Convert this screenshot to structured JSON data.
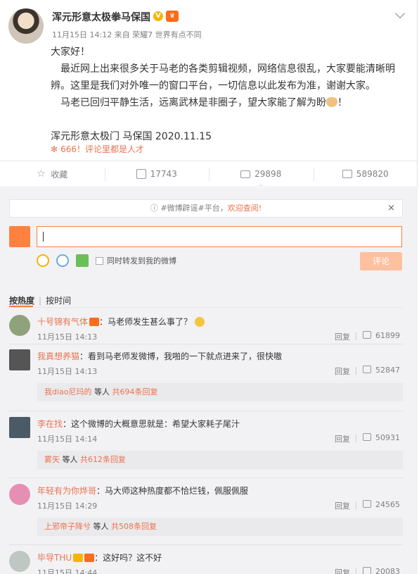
{
  "post": {
    "author": "浑元形意太极拳马保国",
    "verified_badge": "V",
    "meta": "11月15日 14:12 来自 荣耀7 世界有点不同",
    "greeting": "大家好！",
    "para1": "最近网上出来很多关于马老的各类剪辑视频，网络信息很乱，大家要能清晰明辨。这里是我们对外唯一的窗口平台，一切信息以此发布为准，谢谢大家。",
    "para2": "马老已回归平静生活，远离武林是非圈子，望大家能了解为盼",
    "para2_end": "！",
    "signature": "浑元形意太极门   马保国   2020.11.15",
    "hot_comment_tag": "666！评论里都是人才"
  },
  "actions": {
    "favorite": "收藏",
    "repost_count": "17743",
    "comment_count": "29898",
    "like_count": "589820"
  },
  "comment_box": {
    "notice_prefix": "#微博辟谣#平台，",
    "notice_link": "欢迎查阅!",
    "close": "×",
    "repost_checkbox_label": "同时转发到我的微博",
    "submit_label": "评论"
  },
  "sort": {
    "by_hot": "按热度",
    "by_time": "按时间"
  },
  "comments": [
    {
      "user": "十号锦有气体",
      "text": "：马老师发生甚么事了？",
      "time": "11月15日 14:13",
      "reply": "回复",
      "likes": "61899"
    },
    {
      "user": "我真想养猫",
      "text": "：看到马老师发微博，我啪的一下就点进来了，很快嗷",
      "time": "11月15日 14:13",
      "reply": "回复",
      "likes": "52847",
      "more_user": "我diao尼玛的",
      "more_mid": " 等人 ",
      "more_count": "共694条回复"
    },
    {
      "user": "李在找",
      "text": "：这个微博的大概意思就是：希望大家耗子尾汁",
      "time": "11月15日 14:14",
      "reply": "回复",
      "likes": "50931",
      "more_user": "雾矢",
      "more_mid": " 等人 ",
      "more_count": "共612条回复"
    },
    {
      "user": "年轻有为你烨哥",
      "text": "：马大师这种热度都不恰烂钱，佩服佩服",
      "time": "11月15日 14:29",
      "reply": "回复",
      "likes": "24565",
      "more_user": "上邪帝子降兮",
      "more_mid": " 等人 ",
      "more_count": "共508条回复"
    },
    {
      "user": "毕导THU",
      "text": "：这好吗？这不好",
      "time": "11月15日 14:44",
      "reply": "回复",
      "likes": "20083"
    }
  ]
}
